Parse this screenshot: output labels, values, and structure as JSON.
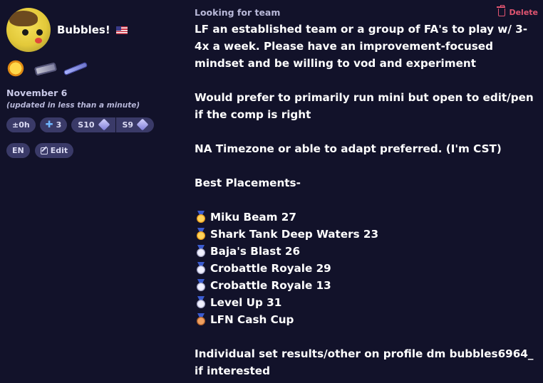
{
  "user": {
    "name": "Bubbles!",
    "flag": "US",
    "date": "November 6",
    "updated": "(updated in less than a minute)"
  },
  "badges": [
    "sun-badge-icon",
    "blaster-badge-icon",
    "charger-badge-icon"
  ],
  "chips": {
    "timezone": "±0h",
    "plus_count": "3",
    "season_a": "S10",
    "season_b": "S9",
    "language": "EN",
    "edit": "Edit"
  },
  "post": {
    "type": "Looking for team",
    "delete_label": "Delete",
    "intro": "LF an established team or a group of FA's to play w/ 3-4x a week. Please have an improvement-focused mindset and be willing to vod and experiment",
    "weapons": "Would prefer to primarily run mini but open to edit/pen if the comp is right",
    "timezone": "NA Timezone or able to adapt preferred. (I'm CST)",
    "placements_header": "Best Placements-",
    "placements": [
      {
        "medal": "gold",
        "text": "Miku Beam 27"
      },
      {
        "medal": "gold",
        "text": "Shark Tank Deep Waters 23"
      },
      {
        "medal": "silver",
        "text": "Baja's Blast 26"
      },
      {
        "medal": "silver",
        "text": "Crobattle Royale 29"
      },
      {
        "medal": "silver",
        "text": "Crobattle Royale 13"
      },
      {
        "medal": "silver",
        "text": "Level Up 31"
      },
      {
        "medal": "bronze",
        "text": "LFN Cash Cup"
      }
    ],
    "footer": "Individual set results/other on profile dm bubbles6964_ if interested"
  },
  "colors": {
    "background": "#12122a",
    "chip": "#3a3a68",
    "delete": "#e05470"
  }
}
